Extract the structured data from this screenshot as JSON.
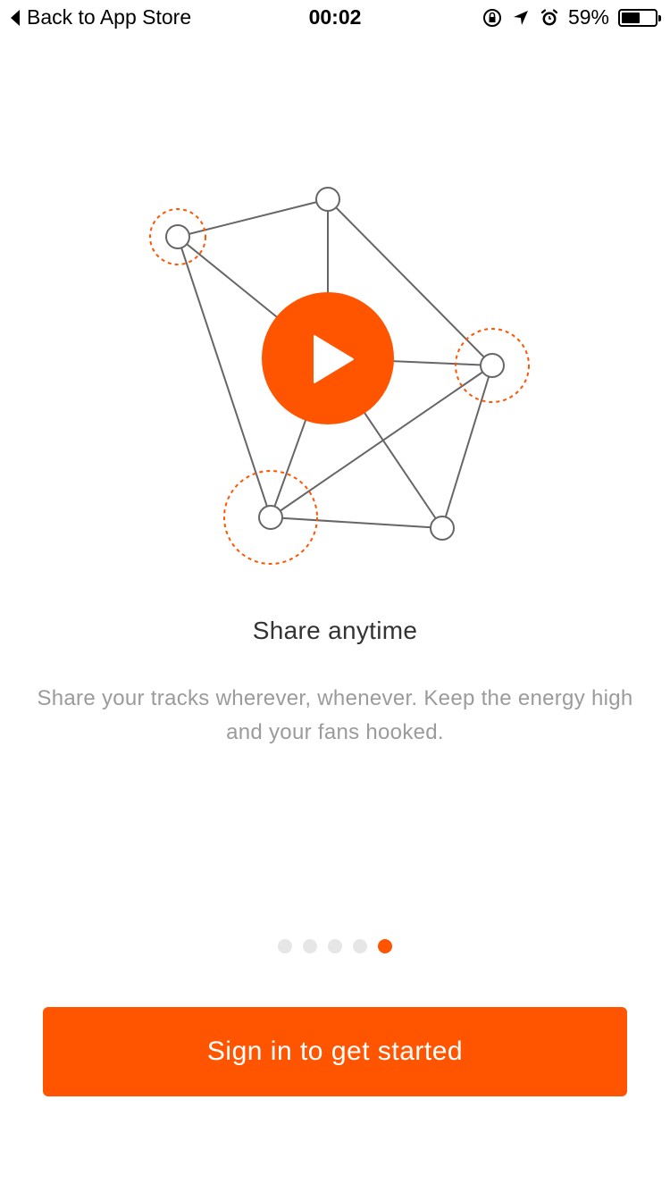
{
  "status_bar": {
    "back_label": "Back to App Store",
    "time": "00:02",
    "battery_percent_label": "59%",
    "battery_level": 0.59,
    "icons": [
      "orientation-lock-icon",
      "location-arrow-icon",
      "alarm-icon",
      "battery-icon"
    ]
  },
  "onboarding": {
    "title": "Share anytime",
    "description": "Share your tracks wherever, whenever. Keep the energy high and your fans hooked.",
    "page_count": 5,
    "current_page": 5,
    "illustration_icon": "play-network-icon"
  },
  "cta": {
    "label": "Sign in to get started"
  },
  "colors": {
    "accent": "#ff5500",
    "dot_inactive": "#e6e6e6",
    "line": "#666666",
    "text_primary": "#333333",
    "text_secondary": "#9b9b9b"
  }
}
